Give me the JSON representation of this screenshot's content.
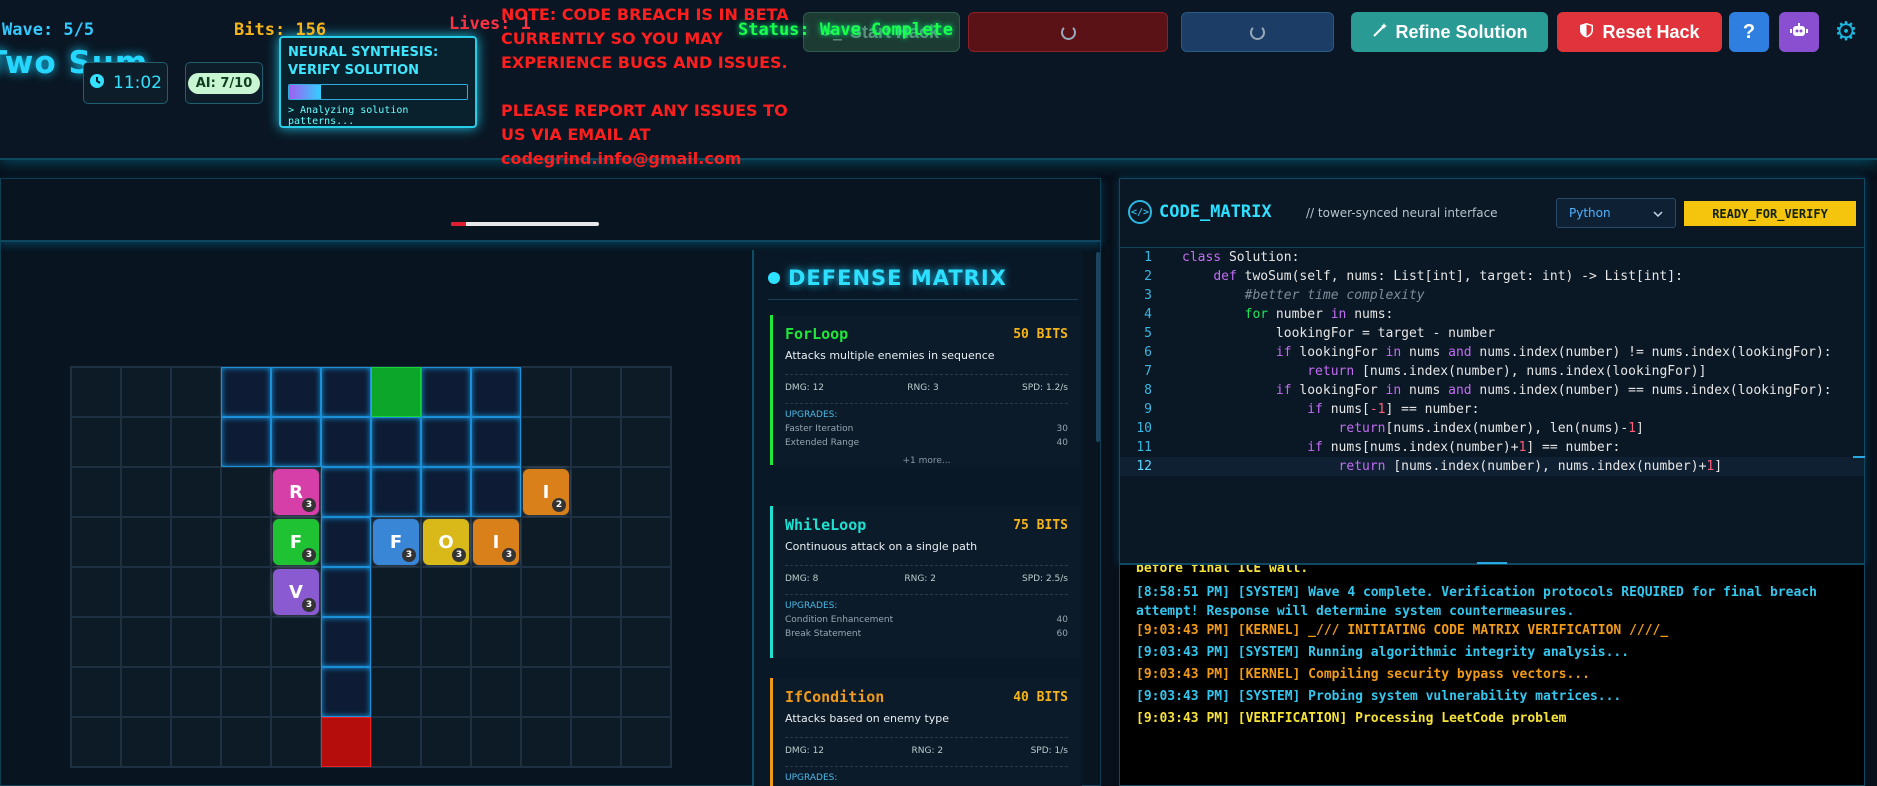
{
  "app": {
    "title": "Two Sum"
  },
  "header": {
    "timer": "11:02",
    "ai_usage": "AI: 7/10",
    "neural": {
      "title": "NEURAL SYNTHESIS: VERIFY SOLUTION",
      "progress": 0.18,
      "log": "> Analyzing solution patterns..."
    },
    "note": "NOTE: CODE BREACH IS IN BETA CURRENTLY SO YOU MAY EXPERIENCE BUGS AND ISSUES.\n\nPLEASE REPORT ANY ISSUES TO US VIA EMAIL AT codegrind.info@gmail.com",
    "buttons": {
      "start": "Start Hack",
      "refine": "Refine Solution",
      "reset": "Reset Hack",
      "help": "?"
    },
    "icons": {
      "timer": "clock-icon",
      "start": "terminal-icon",
      "refine": "wand-icon",
      "reset": "shield-icon",
      "bot": "robot-icon",
      "settings": "gear-icon"
    }
  },
  "game": {
    "wave": "Wave: 5/5",
    "bits": "Bits: 156",
    "lives": "Lives: 1",
    "lives_fraction": 0.1,
    "status": "Status: Wave Complete",
    "towers": [
      {
        "letter": "R",
        "level": "3",
        "color": "#d63fa8"
      },
      {
        "letter": "I",
        "level": "2",
        "color": "#d9801a"
      },
      {
        "letter": "F",
        "level": "3",
        "color": "#1fc233"
      },
      {
        "letter": "F",
        "level": "3",
        "color": "#3a86d6"
      },
      {
        "letter": "O",
        "level": "3",
        "color": "#d9b81a"
      },
      {
        "letter": "I",
        "level": "3",
        "color": "#d9801a"
      },
      {
        "letter": "V",
        "level": "3",
        "color": "#8a5ad0"
      }
    ]
  },
  "defense": {
    "title": "DEFENSE MATRIX",
    "cards": [
      {
        "name": "ForLoop",
        "cost": "50 BITS",
        "desc": "Attacks multiple enemies in sequence",
        "dmg": "DMG: 12",
        "rng": "RNG: 3",
        "spd": "SPD: 1.2/s",
        "upgrades_label": "UPGRADES:",
        "upgrades": [
          {
            "name": "Faster Iteration",
            "cost": "30"
          },
          {
            "name": "Extended Range",
            "cost": "40"
          }
        ],
        "more": "+1 more...",
        "color": "#1fe83a"
      },
      {
        "name": "WhileLoop",
        "cost": "75 BITS",
        "desc": "Continuous attack on a single path",
        "dmg": "DMG: 8",
        "rng": "RNG: 2",
        "spd": "SPD: 2.5/s",
        "upgrades_label": "UPGRADES:",
        "upgrades": [
          {
            "name": "Condition Enhancement",
            "cost": "40"
          },
          {
            "name": "Break Statement",
            "cost": "60"
          }
        ],
        "color": "#1fe0d0"
      },
      {
        "name": "IfCondition",
        "cost": "40 BITS",
        "desc": "Attacks based on enemy type",
        "dmg": "DMG: 12",
        "rng": "RNG: 2",
        "spd": "SPD: 1/s",
        "upgrades_label": "UPGRADES:",
        "color": "#f09a1a"
      }
    ]
  },
  "code": {
    "title": "CODE_MATRIX",
    "subtitle": "// tower-synced neural interface",
    "language": "Python",
    "ready": "READY_FOR_VERIFY",
    "current_line": 12,
    "lines": [
      "class Solution:",
      "    def twoSum(self, nums: List[int], target: int) -> List[int]:",
      "        #better time complexity",
      "        for number in nums:",
      "            lookingFor = target - number",
      "            if lookingFor in nums and nums.index(number) != nums.index(lookingFor):",
      "                return [nums.index(number), nums.index(lookingFor)]",
      "            if lookingFor in nums and nums.index(number) == nums.index(lookingFor):",
      "                if nums[-1] == number:",
      "                    return[nums.index(number), len(nums)-1]",
      "                if nums[nums.index(number)+1] == number:",
      "                    return [nums.index(number), nums.index(number)+1]"
    ]
  },
  "console": {
    "lines": [
      {
        "text": "before final ICE wall.",
        "kind": "ver"
      },
      {
        "text": "[8:58:51 PM] [SYSTEM] Wave 4 complete. Verification protocols REQUIRED for final breach attempt! Response will determine system countermeasures.",
        "kind": "sys"
      },
      {
        "text": "[9:03:43 PM] [KERNEL] _/// INITIATING CODE MATRIX VERIFICATION ////_",
        "kind": "ker"
      },
      {
        "text": "[9:03:43 PM] [SYSTEM] Running algorithmic integrity analysis...",
        "kind": "sys"
      },
      {
        "text": "[9:03:43 PM] [KERNEL] Compiling security bypass vectors...",
        "kind": "ker"
      },
      {
        "text": "[9:03:43 PM] [SYSTEM] Probing system vulnerability matrices...",
        "kind": "sys"
      },
      {
        "text": "[9:03:43 PM] [VERIFICATION] Processing LeetCode problem",
        "kind": "ver"
      }
    ]
  }
}
